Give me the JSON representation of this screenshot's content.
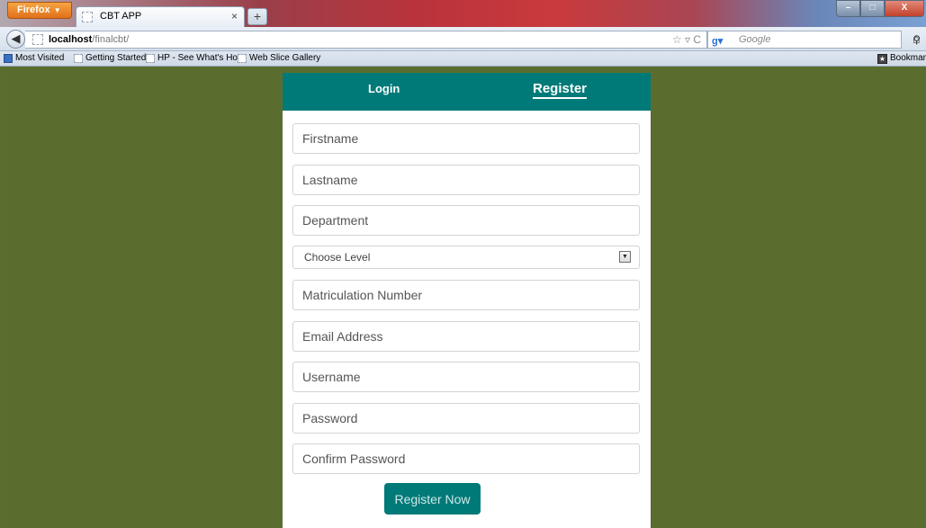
{
  "browser": {
    "app_button": "Firefox",
    "tab_title": "CBT APP",
    "tab_close": "×",
    "new_tab": "+",
    "url_host": "localhost",
    "url_path": "/finalcbt/",
    "search_engine": "Google",
    "window_buttons": {
      "minimize": "–",
      "maximize": "□",
      "close": "X"
    }
  },
  "bookmarks": {
    "items": [
      "Most Visited",
      "Getting Started",
      "HP - See What's Hot",
      "Web Slice Gallery"
    ],
    "right": "Bookmar"
  },
  "form": {
    "tabs": {
      "login": "Login",
      "register": "Register"
    },
    "fields": {
      "firstname": "Firstname",
      "lastname": "Lastname",
      "department": "Department",
      "level": "Choose Level",
      "matric": "Matriculation Number",
      "email": "Email Address",
      "username": "Username",
      "password": "Password",
      "confirm_password": "Confirm Password"
    },
    "submit": "Register Now"
  },
  "colors": {
    "accent": "#007a78",
    "background": "#5a6d2f"
  }
}
